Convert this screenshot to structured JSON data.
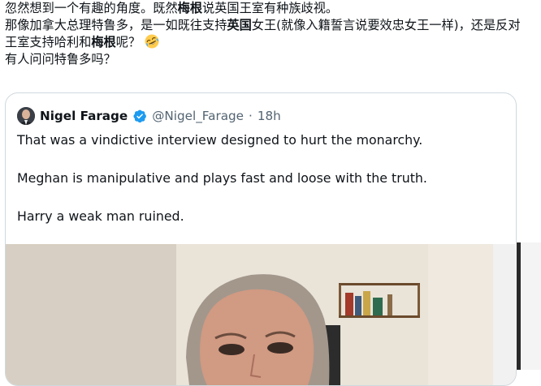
{
  "post": {
    "line1_a": "忽然想到一个有趣的角度。既然",
    "line1_b": "梅根",
    "line1_c": "说英国王室有种族歧视。",
    "line2_a": "那像加拿大总理特鲁多，是一如既往支持",
    "line2_b": "英国",
    "line2_c": "女王(就像入籍誓言说要效忠女王一样)，还是反对王室支持哈利和",
    "line2_d": "梅根",
    "line2_e": "呢？",
    "line2_emoji": "rolling-on-floor-laughing-emoji",
    "line3": "有人问问特鲁多吗？"
  },
  "quote": {
    "author_name": "Nigel Farage",
    "verified_icon": "verified-badge-icon",
    "handle": "@Nigel_Farage",
    "separator": "·",
    "time": "18h",
    "paragraphs": [
      "That was a vindictive interview designed to hurt the monarchy.",
      "Meghan is manipulative and plays fast and loose with the truth.",
      "Harry a weak man ruined."
    ],
    "media": "video-thumbnail"
  },
  "colors": {
    "text": "#0f1419",
    "secondary": "#536471",
    "border": "#cfd9de",
    "verified": "#1d9bf0"
  }
}
